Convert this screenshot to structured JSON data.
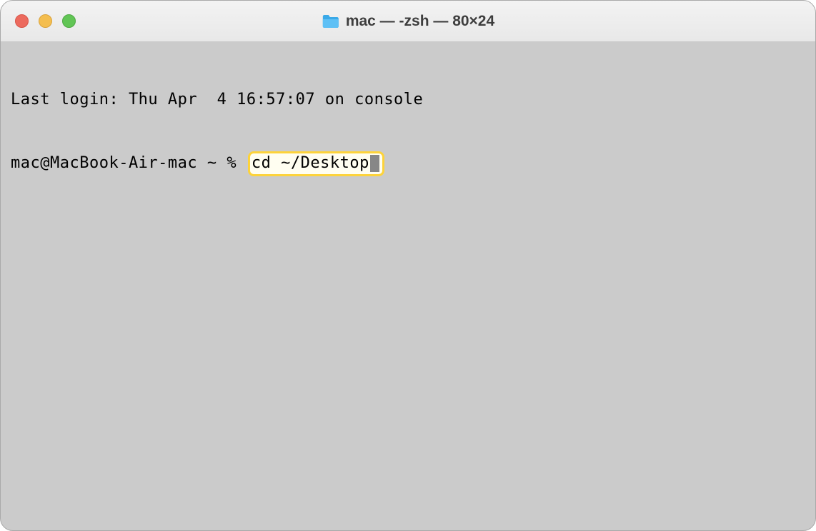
{
  "titlebar": {
    "title": "mac — -zsh — 80×24",
    "folder_icon": "folder-icon"
  },
  "terminal": {
    "login_line": "Last login: Thu Apr  4 16:57:07 on console",
    "prompt": "mac@MacBook-Air-mac ~ % ",
    "command": "cd ~/Desktop"
  },
  "colors": {
    "close": "#ec6a5e",
    "minimize": "#f4be4f",
    "maximize": "#61c555",
    "highlight_bg": "#fffef1",
    "highlight_border": "#fdd33a",
    "cursor": "#878787"
  }
}
